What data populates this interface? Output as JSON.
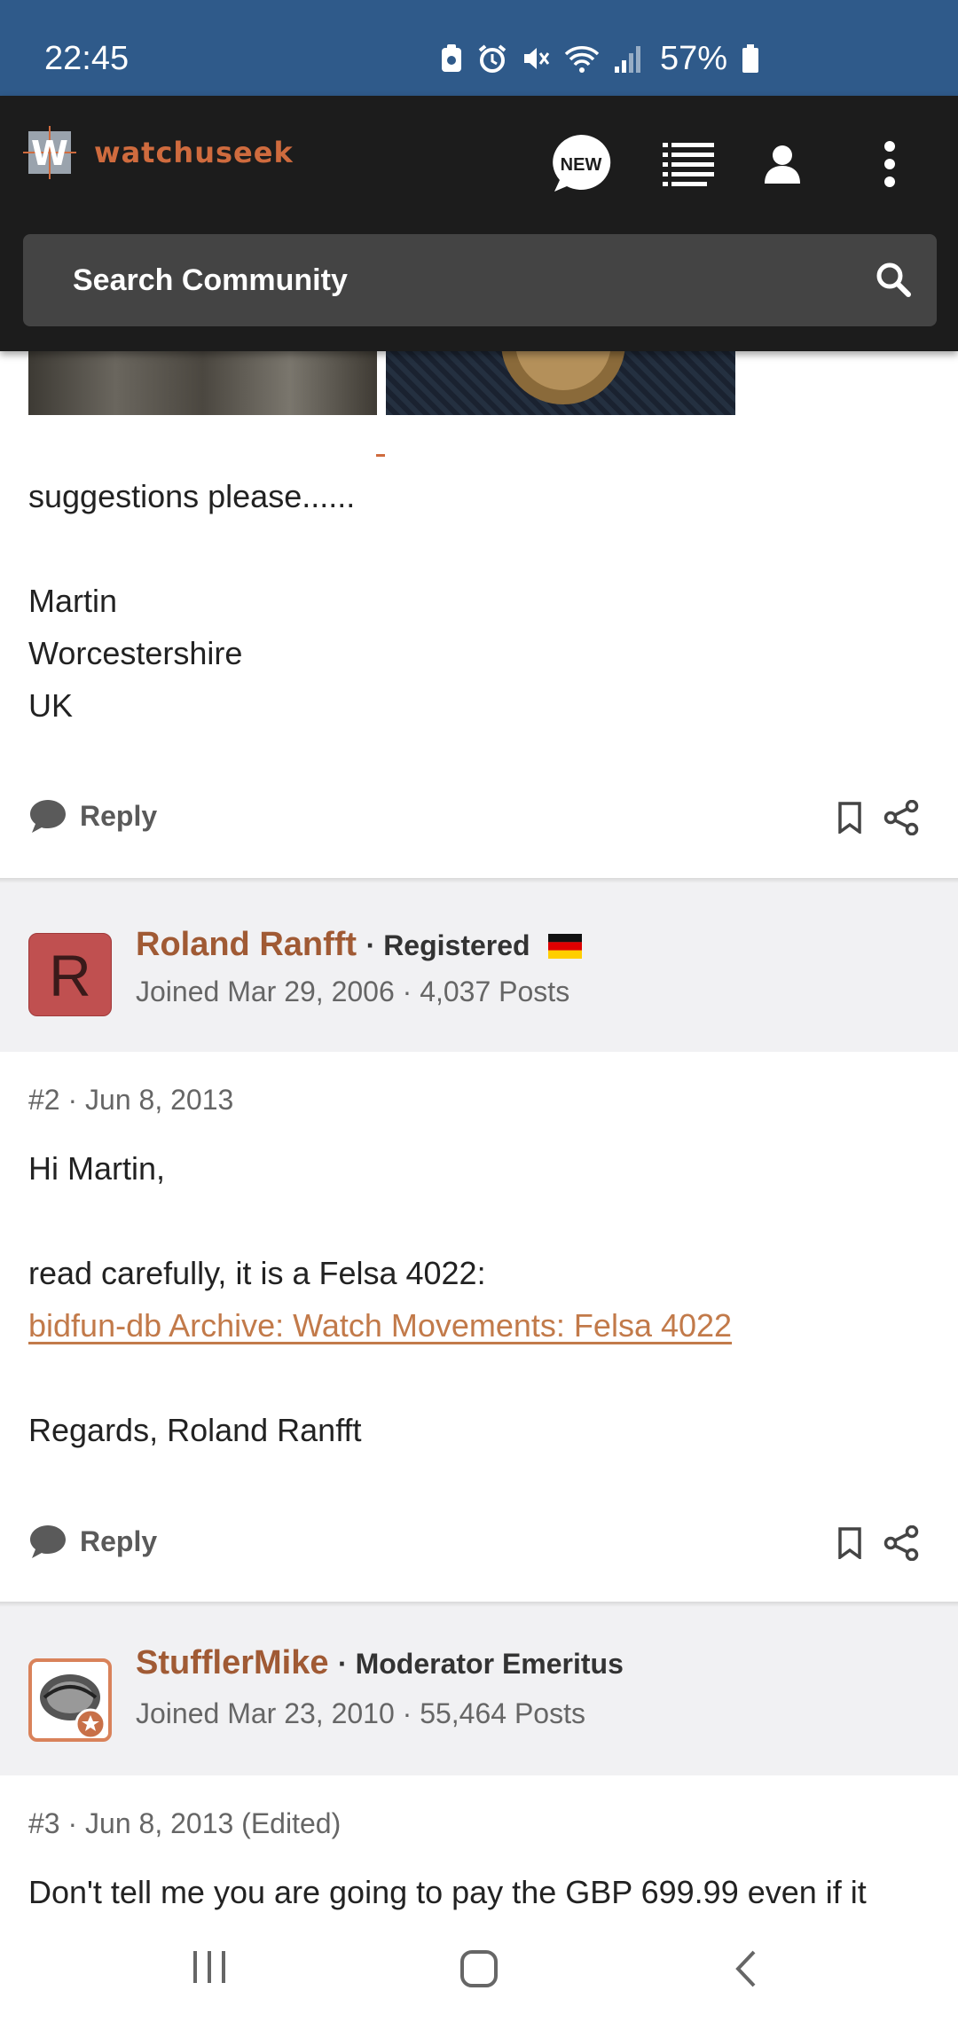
{
  "status_bar": {
    "time": "22:45",
    "battery": "57%",
    "icons": [
      "screenshot-icon",
      "alarm-icon",
      "mute-icon",
      "wifi-icon",
      "signal-icon",
      "battery-icon"
    ]
  },
  "header": {
    "logo_letter": "W",
    "logo_text": "watchuseek",
    "new_badge": "NEW",
    "search_placeholder": "Search Community",
    "colors": {
      "accent": "#cf6b3e",
      "header_bg": "#1c1c1c",
      "status_bg": "#2f5a8a"
    }
  },
  "post1": {
    "lines": [
      "suggestions please......",
      "",
      "Martin",
      "Worcestershire",
      "UK"
    ],
    "reply_label": "Reply"
  },
  "post2": {
    "author": "Roland Ranfft",
    "avatar_letter": "R",
    "role": "Registered",
    "flag": "germany-flag-icon",
    "joined": "Joined Mar 29, 2006 · 4,037 Posts",
    "number": "#2",
    "date": "Jun 8, 2013",
    "greeting": "Hi Martin,",
    "text": "read carefully, it is a Felsa 4022:",
    "link_text": "bidfun-db Archive: Watch Movements: Felsa 4022",
    "signoff": "Regards, Roland Ranfft",
    "reply_label": "Reply"
  },
  "post3": {
    "author": "StufflerMike",
    "role": "Moderator Emeritus",
    "joined": "Joined Mar 23, 2010 · 55,464 Posts",
    "number": "#3",
    "date": "Jun 8, 2013 (Edited)",
    "text": "Don't tell me you are going to pay the GBP 699.99 even if it"
  },
  "nav": [
    "recent-apps-icon",
    "home-icon",
    "back-icon"
  ]
}
